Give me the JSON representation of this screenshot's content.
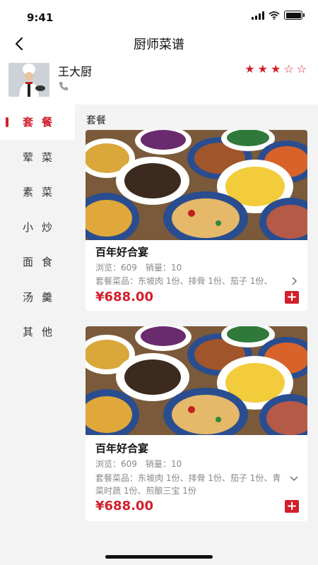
{
  "status": {
    "time": "9:41"
  },
  "nav": {
    "title": "厨师菜谱",
    "back_icon": "chevron-left-icon"
  },
  "chef": {
    "name": "王大厨",
    "rating": 3,
    "rating_max": 5,
    "phone_icon": "phone-icon"
  },
  "sidebar": {
    "items": [
      {
        "label": "套餐",
        "active": true
      },
      {
        "label": "荤菜"
      },
      {
        "label": "素菜"
      },
      {
        "label": "小炒"
      },
      {
        "label": "面食"
      },
      {
        "label": "汤羹"
      },
      {
        "label": "其他"
      }
    ]
  },
  "content": {
    "section_title": "套餐",
    "cards": [
      {
        "name": "百年好合宴",
        "views_label": "浏览：",
        "views": "609",
        "sales_label": "销量：",
        "sales": "10",
        "items_text": "套餐菜品：东坡肉 1份、排骨 1份、茄子 1份、",
        "price": "¥688.00",
        "expanded": false
      },
      {
        "name": "百年好合宴",
        "views_label": "浏览：",
        "views": "609",
        "sales_label": "销量：",
        "sales": "10",
        "items_text": "套餐菜品：东坡肉 1份、排骨 1份、茄子 1份、青菜时蔬 1份、煎酿三宝 1份",
        "price": "¥688.00",
        "expanded": true
      }
    ]
  },
  "colors": {
    "accent": "#d21f2b",
    "muted": "#888888",
    "bg": "#f3f3f3"
  }
}
